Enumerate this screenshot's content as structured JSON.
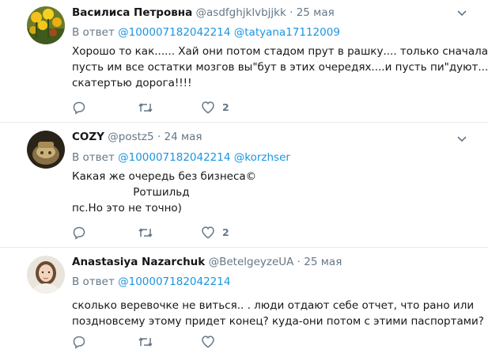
{
  "colors": {
    "link": "#1b95e0",
    "muted": "#657786",
    "text": "#14171a",
    "divider": "#e6ecf0"
  },
  "tweets": [
    {
      "name": "Василиса Петровна",
      "handle": "@asdfghjklvbjjkk",
      "sep": "·",
      "date": "25 мая",
      "reply_prefix": "В ответ",
      "mentions": [
        "@100007182042214",
        "@tatyana17112009"
      ],
      "lines": [
        "Хорошо то как...... Хай они потом стадом прут в рашку.... только сначала",
        "пусть им все остатки мозгов вы\"бут в этих очередях....и пусть пи\"дуют...",
        "скатертью дорога!!!!"
      ],
      "like_count": "2",
      "avatar_icon": "tulips-avatar"
    },
    {
      "name": "COZY",
      "handle": "@postz5",
      "sep": "·",
      "date": "24 мая",
      "reply_prefix": "В ответ",
      "mentions": [
        "@100007182042214",
        "@korzhser"
      ],
      "lines": [
        "Какая же очередь без бизнеса©",
        "                  Ротшильд",
        "пс.Но это не точно)"
      ],
      "like_count": "2",
      "avatar_icon": "bag-avatar"
    },
    {
      "name": "Anastasiya Nazarchuk",
      "handle": "@BetelgeyzeUA",
      "sep": "·",
      "date": "25 мая",
      "reply_prefix": "В ответ",
      "mentions": [
        "@100007182042214"
      ],
      "lines": [
        "сколько веревочке не виться.. . люди отдают себе отчет, что рано или",
        "поздновсему этому придет конец? куда-они потом с этими паспортами?"
      ],
      "like_count": "",
      "avatar_icon": "person-avatar"
    }
  ]
}
